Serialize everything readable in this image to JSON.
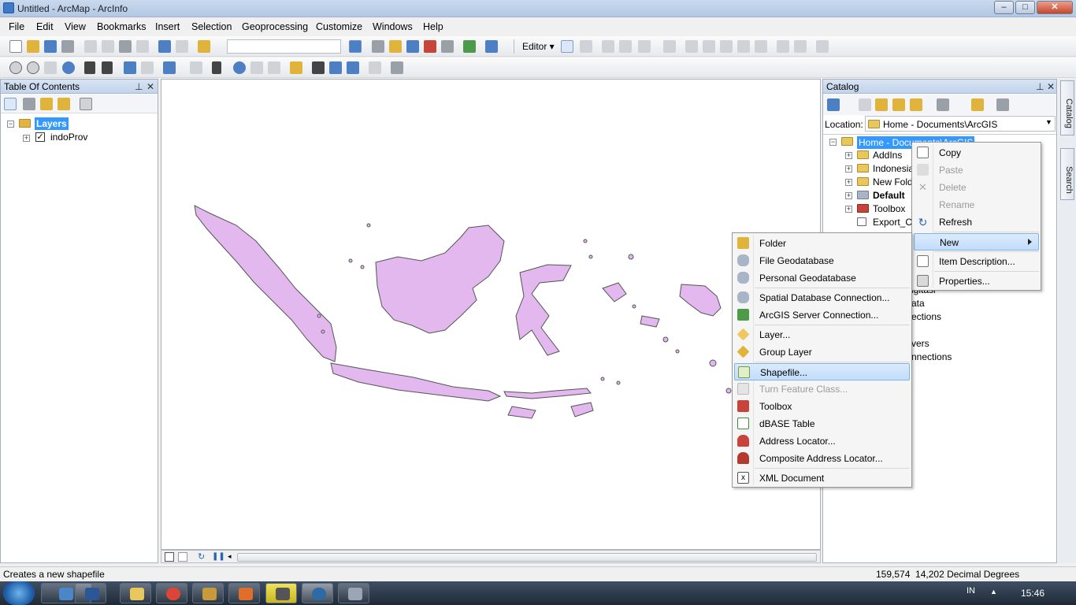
{
  "window": {
    "title": "Untitled - ArcMap - ArcInfo"
  },
  "menubar": [
    "File",
    "Edit",
    "View",
    "Bookmarks",
    "Insert",
    "Selection",
    "Geoprocessing",
    "Customize",
    "Windows",
    "Help"
  ],
  "toolbar": {
    "editor_label": "Editor ▾"
  },
  "toc": {
    "title": "Table Of Contents",
    "layers_label": "Layers",
    "layer_name": "indoProv"
  },
  "catalog": {
    "title": "Catalog",
    "location_label": "Location:",
    "location_value": "Home - Documents\\ArcGIS",
    "root": "Home - Documents\\ArcGIS",
    "items": [
      "AddIns",
      "Indonesia",
      "New Fold",
      "Default",
      "Toolbox",
      "Export_Ou"
    ],
    "partial_rows": [
      "igitasi",
      "ata",
      "ections",
      "vers",
      "nnections"
    ]
  },
  "context_menu": {
    "items": [
      "Copy",
      "Paste",
      "Delete",
      "Rename",
      "Refresh",
      "New",
      "Item Description...",
      "Properties..."
    ]
  },
  "new_submenu": {
    "items": [
      "Folder",
      "File Geodatabase",
      "Personal Geodatabase",
      "Spatial Database Connection...",
      "ArcGIS Server Connection...",
      "Layer...",
      "Group Layer",
      "Shapefile...",
      "Turn Feature Class...",
      "Toolbox",
      "dBASE Table",
      "Address Locator...",
      "Composite Address Locator...",
      "XML Document"
    ],
    "highlighted": "Shapefile...",
    "disabled": [
      "Turn Feature Class..."
    ]
  },
  "side_tabs": [
    "Catalog",
    "Search"
  ],
  "status": {
    "message": "Creates a new shapefile",
    "coords": "159,574  14,202 Decimal Degrees"
  },
  "taskbar": {
    "lang": "IN",
    "time": "15:46"
  },
  "colors": {
    "map_fill": "#e2b8ef",
    "map_stroke": "#555555",
    "highlight": "#c1dcfb"
  }
}
